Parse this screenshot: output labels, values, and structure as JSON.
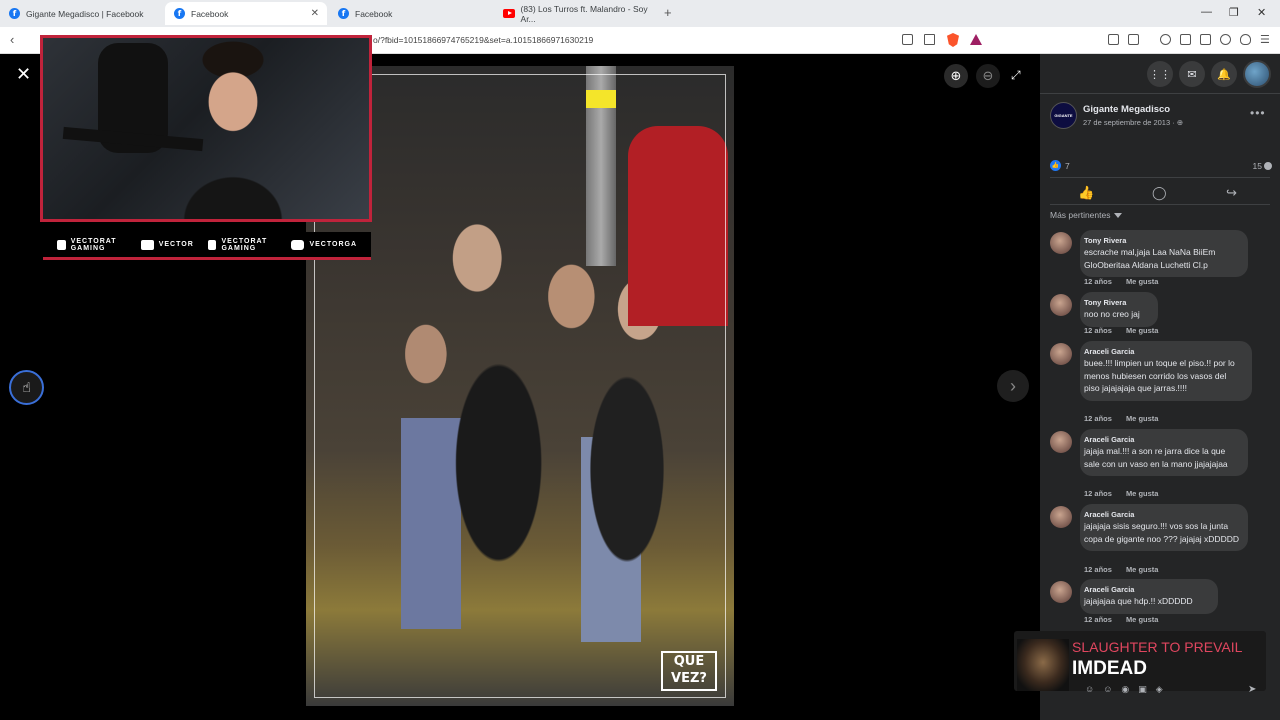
{
  "tabs": [
    {
      "label": "Gigante Megadisco | Facebook",
      "icon": "facebook-icon",
      "active": false
    },
    {
      "label": "Facebook",
      "icon": "facebook-icon",
      "active": true
    },
    {
      "label": "Facebook",
      "icon": "facebook-icon",
      "active": false
    },
    {
      "label": "(83) Los Turros ft. Malandro - Soy Ar...",
      "icon": "youtube-icon",
      "active": false
    }
  ],
  "address": {
    "url": "o/?fbid=10151866974765219&set=a.10151866971630219"
  },
  "stream_overlay": {
    "socials": [
      {
        "icon": "youtube-icon",
        "label": "VECTORAT GAMING"
      },
      {
        "icon": "twitch-icon",
        "label": "VECTOR"
      },
      {
        "icon": "twitter-icon",
        "label": "VECTORAT GAMING"
      },
      {
        "icon": "instagram-icon",
        "label": "VECTORGA"
      }
    ]
  },
  "photo": {
    "watermark": "QUE VEZ?"
  },
  "post": {
    "page_name": "Gigante Megadisco",
    "date": "27 de septiembre de 2013 · ",
    "like_count": "7",
    "comment_count": "15",
    "sort_label": "Más pertinentes"
  },
  "comments": [
    {
      "author": "Tony Rivera",
      "text": "escrache mal,jaja Laa NaNa BiiEm GloOberitaa Aldana Luchetti Cl.p",
      "time": "12 años",
      "like": "Me gusta"
    },
    {
      "author": "Tony Rivera",
      "text": "noo no creo jaj",
      "time": "12 años",
      "like": "Me gusta"
    },
    {
      "author": "Araceli Garcia",
      "text": "buee.!!! limpien un toque el piso.!! por lo menos hubiesen corrido los vasos del piso jajajajaja que jarras.!!!!",
      "time": "12 años",
      "like": "Me gusta"
    },
    {
      "author": "Araceli Garcia",
      "text": "jajaja mal.!!! a son re jarra dice la que sale con un vaso en la mano jjajajajaa",
      "time": "12 años",
      "like": "Me gusta"
    },
    {
      "author": "Araceli Garcia",
      "text": "jajajaja sisis seguro.!!! vos sos la junta copa de gigante noo ??? jajajaj xDDDDD",
      "time": "12 años",
      "like": "Me gusta"
    },
    {
      "author": "Araceli Garcia",
      "text": "jajajajaa que hdp.!! xDDDDD",
      "time": "12 años",
      "like": "Me gusta"
    }
  ],
  "now_playing": {
    "artist": "SLAUGHTER TO PREVAIL",
    "title": "IMDEAD"
  },
  "colors": {
    "facebook_blue": "#1877f2",
    "overlay_red": "#c0233b",
    "sidebar_bg": "#242526",
    "bubble_bg": "#3a3b3c"
  }
}
